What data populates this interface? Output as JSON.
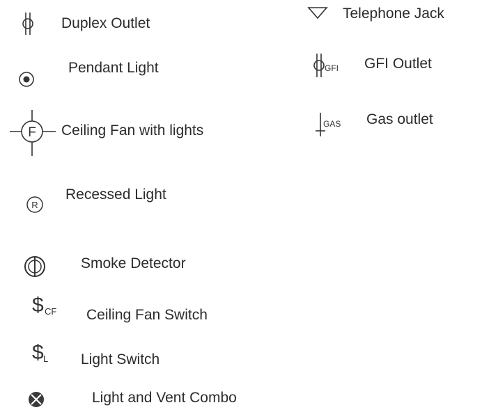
{
  "legend": {
    "duplex_outlet": {
      "label": "Duplex Outlet",
      "icon": "duplex-outlet-icon"
    },
    "pendant_light": {
      "label": "Pendant Light",
      "icon": "pendant-light-icon"
    },
    "ceiling_fan_lights": {
      "label": "Ceiling Fan with lights",
      "icon": "ceiling-fan-icon",
      "glyph": "F"
    },
    "recessed_light": {
      "label": "Recessed Light",
      "icon": "recessed-light-icon",
      "glyph": "R"
    },
    "smoke_detector": {
      "label": "Smoke Detector",
      "icon": "smoke-detector-icon"
    },
    "ceiling_fan_switch": {
      "label": "Ceiling Fan Switch",
      "icon": "ceiling-fan-switch-icon",
      "glyph": "$",
      "sub": "CF"
    },
    "light_switch": {
      "label": "Light Switch",
      "icon": "light-switch-icon",
      "glyph": "$",
      "sub": "L"
    },
    "light_vent_combo": {
      "label": "Light and Vent Combo",
      "icon": "light-vent-combo-icon"
    },
    "telephone_jack": {
      "label": "Telephone Jack",
      "icon": "telephone-jack-icon"
    },
    "gfi_outlet": {
      "label": "GFI Outlet",
      "icon": "gfi-outlet-icon",
      "sub": "GFI"
    },
    "gas_outlet": {
      "label": "Gas outlet",
      "icon": "gas-outlet-icon",
      "sub": "GAS"
    }
  }
}
